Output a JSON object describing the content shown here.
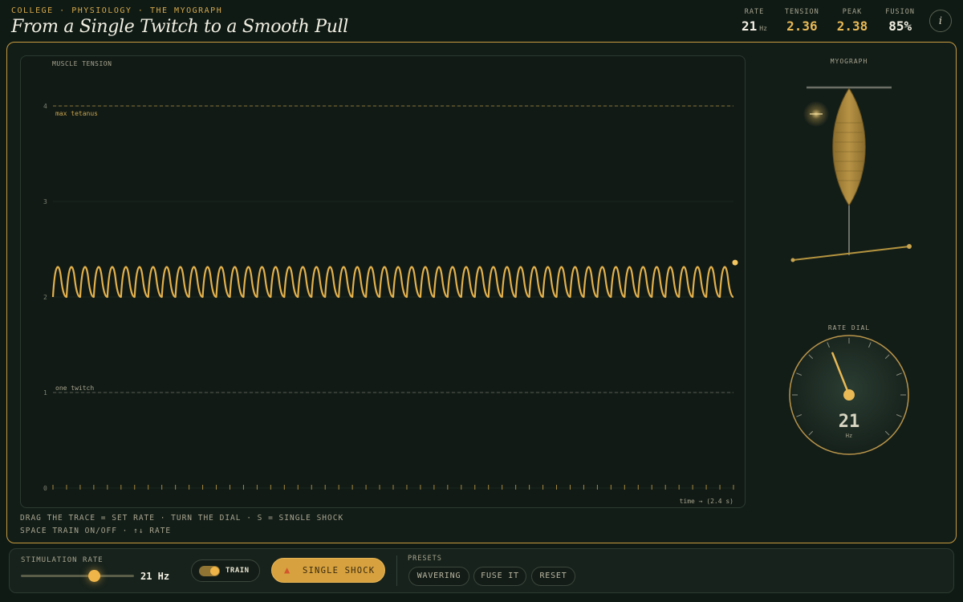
{
  "header": {
    "breadcrumb": "COLLEGE · PHYSIOLOGY · THE MYOGRAPH",
    "title": "From a Single Twitch to a Smooth Pull"
  },
  "stats": {
    "rate": {
      "label": "RATE",
      "value": "21",
      "unit": "Hz"
    },
    "tension": {
      "label": "TENSION",
      "value": "2.36"
    },
    "peak": {
      "label": "PEAK",
      "value": "2.38"
    },
    "fusion": {
      "label": "FUSION",
      "value": "85%"
    }
  },
  "plot": {
    "title": "MUSCLE TENSION",
    "max_line_label": "max tetanus",
    "twitch_line_label": "one twitch",
    "time_label": "time → (2.4 s)"
  },
  "chart_data": {
    "type": "line",
    "title": "MUSCLE TENSION",
    "xlabel": "time → (2.4 s)",
    "ylabel": "",
    "ylim": [
      0,
      4
    ],
    "yticks": [
      "0",
      "1",
      "2",
      "3",
      "4"
    ],
    "x_range_s": [
      0,
      2.4
    ],
    "reference_lines": [
      {
        "label": "max tetanus",
        "y": 4
      },
      {
        "label": "one twitch",
        "y": 1
      }
    ],
    "series": [
      {
        "stimulation_rate_hz": 21,
        "trough": 2.0,
        "peak": 2.38,
        "current": 2.36
      }
    ],
    "grid": false
  },
  "myograph": {
    "label": "MYOGRAPH"
  },
  "dial": {
    "label": "RATE DIAL",
    "value": "21",
    "unit": "Hz",
    "fraction": 0.42
  },
  "hints": {
    "line1": "DRAG THE TRACE = SET RATE · TURN THE DIAL · S = SINGLE SHOCK",
    "line2": "SPACE TRAIN ON/OFF · ↑↓ RATE"
  },
  "controls": {
    "rate_label": "STIMULATION RATE",
    "rate_value": "21 Hz",
    "rate_fraction": 0.42,
    "train_label": "TRAIN",
    "train_on": true,
    "shock_icon": "lightning-icon",
    "shock_label": "SINGLE SHOCK",
    "presets_label": "PRESETS",
    "presets": [
      "WAVERING",
      "FUSE IT",
      "RESET"
    ]
  },
  "colors": {
    "accent": "#e9b955",
    "frame": "#c79b3f",
    "background": "#0f1a15"
  }
}
